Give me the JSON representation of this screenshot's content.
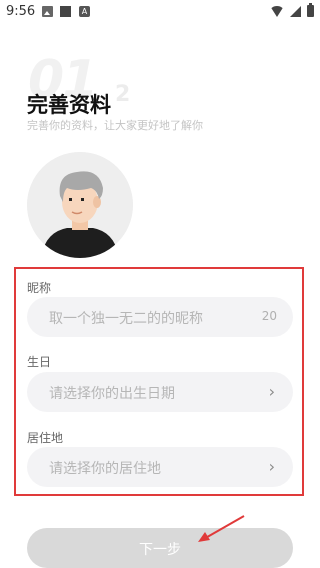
{
  "status_bar": {
    "time": "9:56",
    "icons": [
      "image-icon",
      "square-icon",
      "a-icon",
      "wifi-icon",
      "signal-icon",
      "battery-icon"
    ]
  },
  "header": {
    "decoration": "01",
    "decoration_small": "2",
    "title": "完善资料",
    "subtitle": "完善你的资料，让大家更好地了解你"
  },
  "form": {
    "nickname": {
      "label": "昵称",
      "placeholder": "取一个独一无二的的昵称",
      "counter": "20"
    },
    "birthday": {
      "label": "生日",
      "placeholder": "请选择你的出生日期"
    },
    "residence": {
      "label": "居住地",
      "placeholder": "请选择你的居住地"
    }
  },
  "next_button": {
    "label": "下一步"
  },
  "colors": {
    "highlight_border": "#e03a3a",
    "field_bg": "#f3f3f5",
    "button_disabled": "#d9d9d9"
  }
}
